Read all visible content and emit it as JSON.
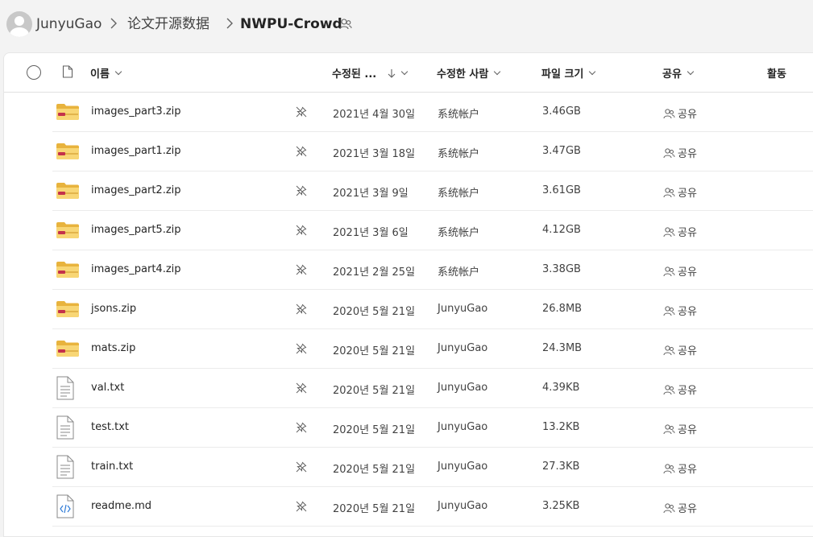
{
  "breadcrumb": {
    "user": "JunyuGao",
    "folder": "论文开源数据",
    "current": "NWPU-Crowd",
    "separator": ">"
  },
  "columns": {
    "name": "이름",
    "modified": "수정된 ...",
    "modified_by": "수정한 사람",
    "size": "파일 크기",
    "sharing": "공유",
    "activity": "활동"
  },
  "files": [
    {
      "name": "images_part3.zip",
      "type": "zip-folder",
      "modified": "2021년 4월 30일",
      "modified_by": "系统帐户",
      "size": "3.46GB",
      "sharing": "공유"
    },
    {
      "name": "images_part1.zip",
      "type": "zip-folder",
      "modified": "2021년 3월 18일",
      "modified_by": "系统帐户",
      "size": "3.47GB",
      "sharing": "공유"
    },
    {
      "name": "images_part2.zip",
      "type": "zip-folder",
      "modified": "2021년 3월 9일",
      "modified_by": "系统帐户",
      "size": "3.61GB",
      "sharing": "공유"
    },
    {
      "name": "images_part5.zip",
      "type": "zip-folder",
      "modified": "2021년 3월 6일",
      "modified_by": "系统帐户",
      "size": "4.12GB",
      "sharing": "공유"
    },
    {
      "name": "images_part4.zip",
      "type": "zip-folder",
      "modified": "2021년 2월 25일",
      "modified_by": "系统帐户",
      "size": "3.38GB",
      "sharing": "공유"
    },
    {
      "name": "jsons.zip",
      "type": "zip-folder",
      "modified": "2020년 5월 21일",
      "modified_by": "JunyuGao",
      "size": "26.8MB",
      "sharing": "공유"
    },
    {
      "name": "mats.zip",
      "type": "zip-folder",
      "modified": "2020년 5월 21일",
      "modified_by": "JunyuGao",
      "size": "24.3MB",
      "sharing": "공유"
    },
    {
      "name": "val.txt",
      "type": "text-file",
      "modified": "2020년 5월 21일",
      "modified_by": "JunyuGao",
      "size": "4.39KB",
      "sharing": "공유"
    },
    {
      "name": "test.txt",
      "type": "text-file",
      "modified": "2020년 5월 21일",
      "modified_by": "JunyuGao",
      "size": "13.2KB",
      "sharing": "공유"
    },
    {
      "name": "train.txt",
      "type": "text-file",
      "modified": "2020년 5월 21일",
      "modified_by": "JunyuGao",
      "size": "27.3KB",
      "sharing": "공유"
    },
    {
      "name": "readme.md",
      "type": "code-file",
      "modified": "2020년 5월 21일",
      "modified_by": "JunyuGao",
      "size": "3.25KB",
      "sharing": "공유"
    }
  ],
  "colors": {
    "folder_yellow": "#f8d675",
    "folder_dark": "#e8b33d",
    "zip_red": "#c4314b",
    "code_blue": "#2f7bd6"
  }
}
